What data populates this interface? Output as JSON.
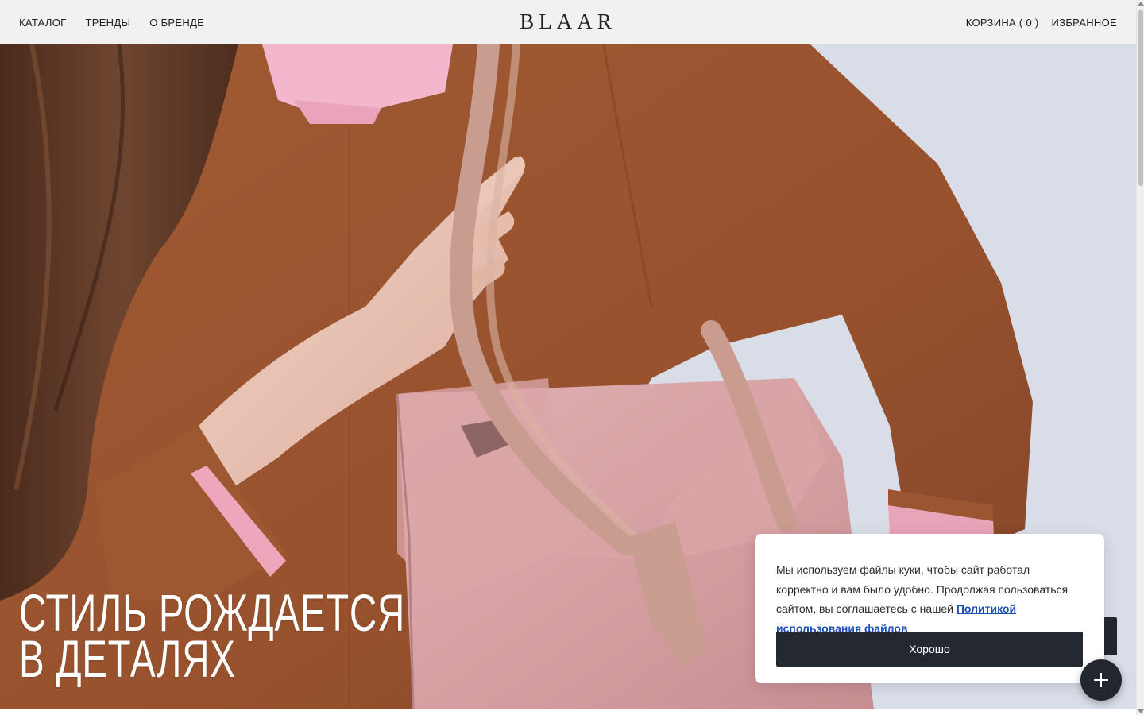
{
  "header": {
    "nav_left": [
      "КАТАЛОГ",
      "ТРЕНДЫ",
      "О БРЕНДЕ"
    ],
    "logo": "BLAAR",
    "cart_label": "КОРЗИНА ( 0 )",
    "favorites_label": "ИЗБРАННОЕ"
  },
  "hero": {
    "title_line1": "СТИЛЬ РОЖДАЕТСЯ",
    "title_line2": "В ДЕТАЛЯХ"
  },
  "cookie": {
    "text": "Мы используем файлы куки, чтобы сайт работал корректно и вам было удобно. Продолжая пользоваться сайтом, вы соглашаетесь с нашей ",
    "link_text": "Политикой использования файлов",
    "button_label": "Хорошо"
  },
  "colors": {
    "header_bg": "#f1f1f1",
    "button_dark": "#242831",
    "link": "#1b4fb3",
    "sweater": "#9a5530",
    "bag": "#d9a6a8"
  },
  "icons": {
    "fab": "plus-icon"
  }
}
